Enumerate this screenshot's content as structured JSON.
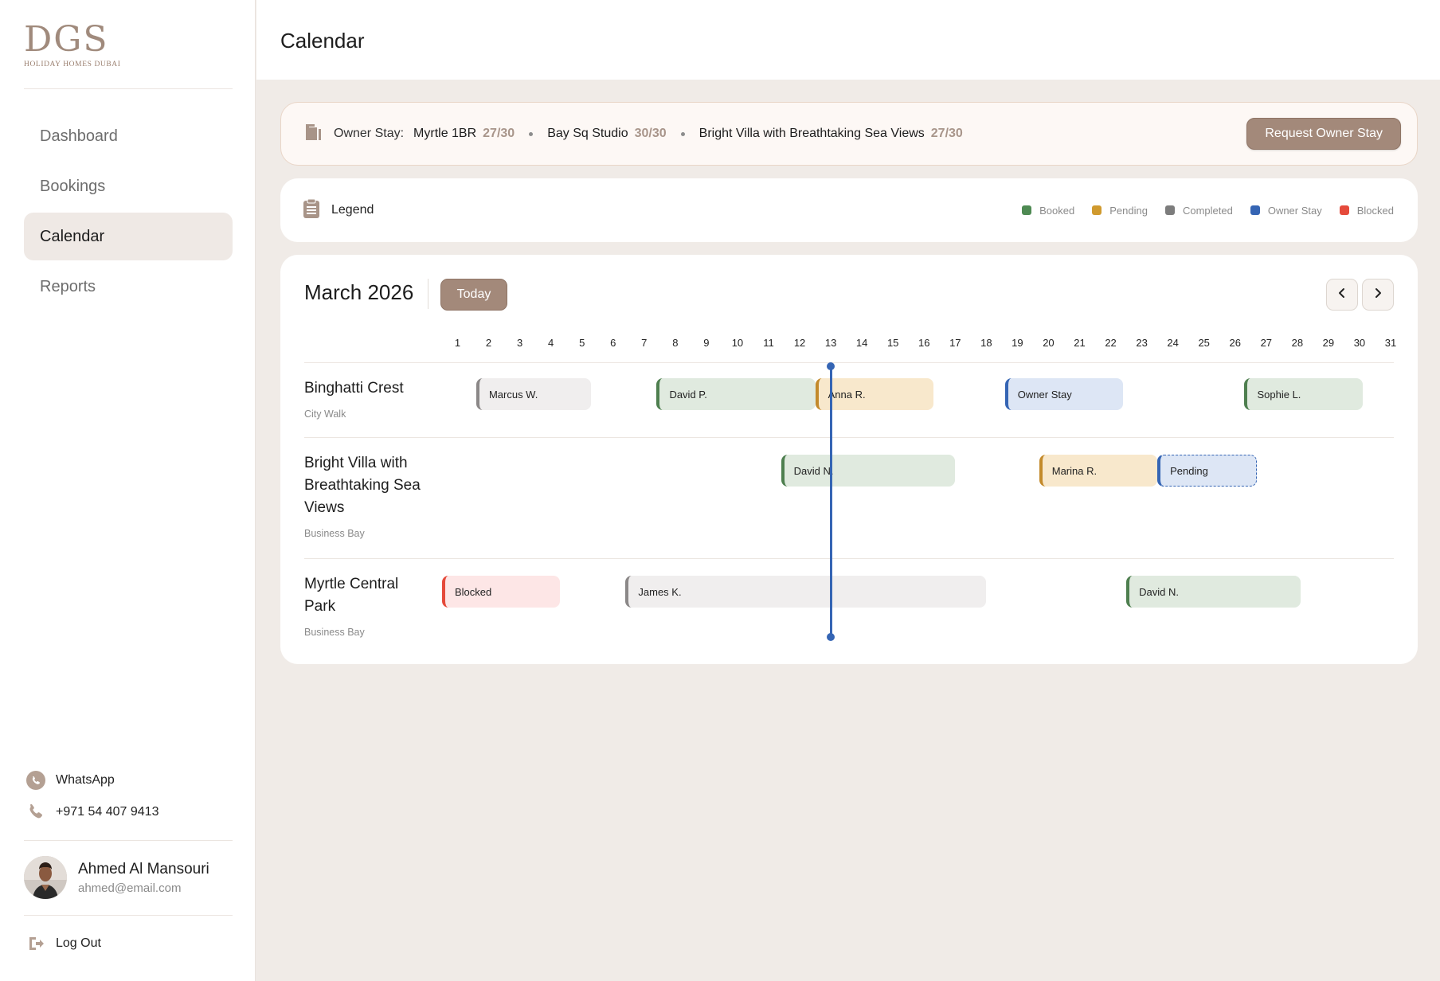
{
  "brand": {
    "logo_mark": "DGS",
    "logo_sub": "HOLIDAY HOMES DUBAI"
  },
  "header": {
    "title": "Calendar"
  },
  "sidebar": {
    "items": [
      {
        "label": "Dashboard",
        "active": false
      },
      {
        "label": "Bookings",
        "active": false
      },
      {
        "label": "Calendar",
        "active": true
      },
      {
        "label": "Reports",
        "active": false
      }
    ],
    "whatsapp_label": "WhatsApp",
    "phone": "+971 54 407 9413",
    "user": {
      "name": "Ahmed Al Mansouri",
      "email": "ahmed@email.com"
    },
    "logout_label": "Log Out"
  },
  "owner_stay": {
    "label": "Owner Stay:",
    "properties": [
      {
        "name": "Myrtle 1BR",
        "count": "27/30"
      },
      {
        "name": "Bay Sq Studio",
        "count": "30/30"
      },
      {
        "name": "Bright Villa with Breathtaking Sea Views",
        "count": "27/30"
      }
    ],
    "button_label": "Request Owner Stay"
  },
  "legend": {
    "title": "Legend",
    "items": [
      {
        "label": "Booked",
        "color": "#4e8a53"
      },
      {
        "label": "Pending",
        "color": "#d09a2e"
      },
      {
        "label": "Completed",
        "color": "#7c7c7c"
      },
      {
        "label": "Owner Stay",
        "color": "#3565b4"
      },
      {
        "label": "Blocked",
        "color": "#e54a3b"
      }
    ]
  },
  "calendar": {
    "month_label": "March 2026",
    "today_label": "Today",
    "prev_icon": "chevron-left-icon",
    "next_icon": "chevron-right-icon",
    "days": [
      "1",
      "2",
      "3",
      "4",
      "5",
      "6",
      "7",
      "8",
      "9",
      "10",
      "11",
      "12",
      "13",
      "14",
      "15",
      "16",
      "17",
      "18",
      "19",
      "20",
      "21",
      "22",
      "23",
      "24",
      "25",
      "26",
      "27",
      "28",
      "29",
      "30",
      "31"
    ],
    "today_day": 13,
    "properties": [
      {
        "name": "Binghatti Crest",
        "location": "City Walk",
        "bookings": [
          {
            "label": "Marcus W.",
            "status": "completed",
            "start": 2.1,
            "end": 5.8
          },
          {
            "label": "David P.",
            "status": "booked",
            "start": 7.9,
            "end": 13.0
          },
          {
            "label": "Anna R.",
            "status": "pending",
            "start": 13.0,
            "end": 16.8
          },
          {
            "label": "Owner Stay",
            "status": "owner",
            "start": 19.1,
            "end": 22.9
          },
          {
            "label": "Sophie L.",
            "status": "booked",
            "start": 26.8,
            "end": 30.6
          }
        ]
      },
      {
        "name": "Bright Villa with Breathtaking Sea Views",
        "location": "Business Bay",
        "bookings": [
          {
            "label": "David N.",
            "status": "booked",
            "start": 11.9,
            "end": 17.5
          },
          {
            "label": "Marina R.",
            "status": "pending",
            "start": 20.2,
            "end": 24.0
          },
          {
            "label": "Pending",
            "status": "pending-owner",
            "start": 24.0,
            "end": 27.2
          }
        ]
      },
      {
        "name": "Myrtle Central Park",
        "location": "Business Bay",
        "bookings": [
          {
            "label": "Blocked",
            "status": "blocked",
            "start": 1.0,
            "end": 4.8
          },
          {
            "label": "James K.",
            "status": "completed",
            "start": 6.9,
            "end": 18.5
          },
          {
            "label": "David N.",
            "status": "booked",
            "start": 23.0,
            "end": 28.6
          }
        ]
      }
    ]
  }
}
